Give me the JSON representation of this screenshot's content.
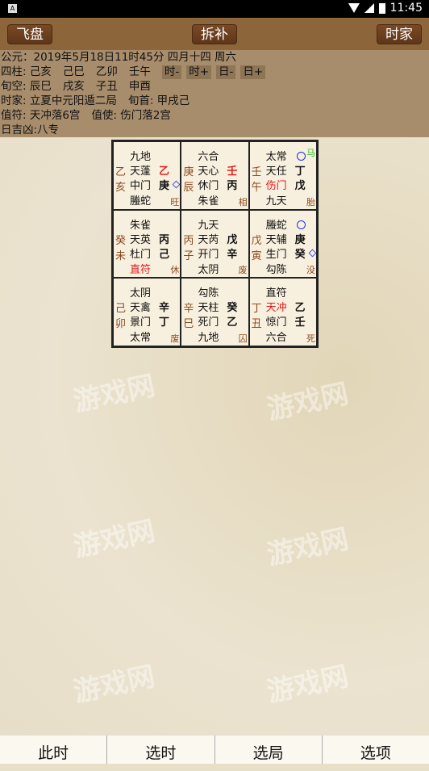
{
  "status_bar": {
    "time": "11:45",
    "icons": [
      "notification-a-icon",
      "wifi-icon",
      "signal-icon",
      "battery-icon"
    ]
  },
  "header": {
    "left_button": "飞盘",
    "center_button": "拆补",
    "right_button": "时家"
  },
  "info": {
    "gregorian": "公元：2019年5月18日11时45分 四月十四 周六",
    "pillars_label": "四柱:",
    "pillars": [
      "己亥",
      "己巳",
      "乙卯",
      "壬午"
    ],
    "shift_buttons": [
      "时-",
      "时+",
      "日-",
      "日+"
    ],
    "xunkong_label": "旬空:",
    "xunkong": [
      "辰巳",
      "戌亥",
      "子丑",
      "申酉"
    ],
    "shijia": "时家: 立夏中元阳遁二局",
    "xunshou": "旬首: 甲戌己",
    "zhifu": "值符: 天冲落6宫",
    "zhishi": "值使: 伤门落2宫",
    "riji": "日吉凶:八专"
  },
  "palaces": [
    {
      "stem_branch": [
        "乙",
        "亥"
      ],
      "god": "九地",
      "star": "天蓬",
      "door": "中门",
      "god2": "螣蛇",
      "s1": "乙",
      "s2": "庚",
      "corner": "旺",
      "s1_red": true,
      "diamond": true
    },
    {
      "stem_branch": [
        "庚",
        "辰"
      ],
      "god": "六合",
      "star": "天心",
      "door": "休门",
      "god2": "朱雀",
      "s1": "壬",
      "s2": "丙",
      "corner": "相",
      "s1_red": true
    },
    {
      "stem_branch": [
        "壬",
        "午"
      ],
      "god": "太常",
      "star": "天任",
      "door": "伤门",
      "god2": "九天",
      "s1": "丁",
      "s2": "戊",
      "corner": "胎",
      "door_red": true,
      "circle": true,
      "horse": "马"
    },
    {
      "stem_branch": [
        "癸",
        "未"
      ],
      "god": "朱雀",
      "star": "天英",
      "door": "杜门",
      "god2": "直符",
      "s1": "丙",
      "s2": "己",
      "corner": "休",
      "god2_red": true
    },
    {
      "stem_branch": [
        "丙",
        "子"
      ],
      "god": "九天",
      "star": "天芮",
      "door": "开门",
      "god2": "太阴",
      "s1": "戊",
      "s2": "辛",
      "corner": "废"
    },
    {
      "stem_branch": [
        "戊",
        "寅"
      ],
      "god": "螣蛇",
      "star": "天辅",
      "door": "生门",
      "god2": "勾陈",
      "s1": "庚",
      "s2": "癸",
      "corner": "没",
      "circle": true,
      "diamond": true
    },
    {
      "stem_branch": [
        "己",
        "卯"
      ],
      "god": "太阴",
      "star": "天禽",
      "door": "景门",
      "god2": "太常",
      "s1": "辛",
      "s2": "丁",
      "corner": "废"
    },
    {
      "stem_branch": [
        "辛",
        "巳"
      ],
      "god": "勾陈",
      "star": "天柱",
      "door": "死门",
      "god2": "九地",
      "s1": "癸",
      "s2": "乙",
      "corner": "囚"
    },
    {
      "stem_branch": [
        "丁",
        "丑"
      ],
      "god": "直符",
      "star": "天冲",
      "door": "惊门",
      "god2": "六合",
      "s1": "乙",
      "s2": "壬",
      "corner": "死",
      "star_red": true
    }
  ],
  "watermark": "游戏网",
  "bottom_tabs": [
    "此时",
    "选时",
    "选局",
    "选项"
  ],
  "colors": {
    "header": "#8d653a",
    "info": "#a88d6c",
    "red": "#e21b1b",
    "stem": "#8b4a1e",
    "circle": "#2233dd",
    "horse": "#22bb22"
  }
}
